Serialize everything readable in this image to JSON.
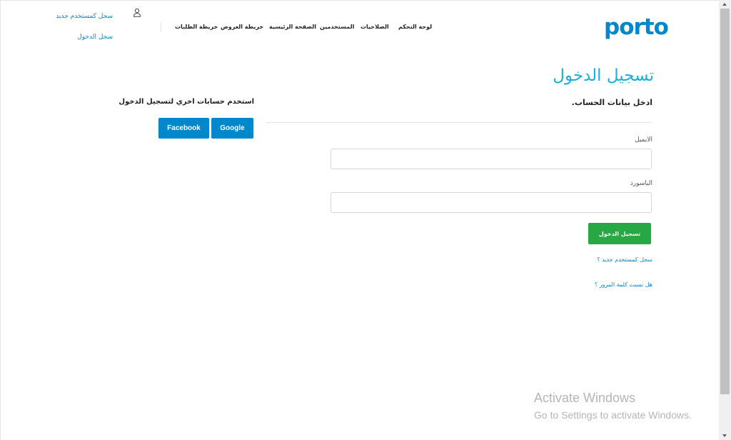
{
  "header": {
    "logo": "porto",
    "nav": [
      {
        "label": "لوحة التحكم"
      },
      {
        "label": "الصلاحيات"
      },
      {
        "label": "المستخدمين"
      },
      {
        "label": "الصفحة الرئيسية"
      },
      {
        "label": "خريطة العروض"
      },
      {
        "label": "خريطة الطلبات"
      }
    ],
    "register_link": "سجل كمستخدم جديد",
    "login_link": "سجل الدخول"
  },
  "main": {
    "page_title": "تسجيل الدخول",
    "form_title": "ادخل بيانات الحساب.",
    "email_label": "الايميل",
    "email_value": "",
    "password_label": "الباسورد",
    "password_value": "",
    "login_button": "تسجيل الدخول",
    "register_link": "سجل كمستخدم جديد ؟",
    "forgot_link": "هل نسيت كلمة المرور ؟"
  },
  "social": {
    "title": "استخدم حسابات اخري لتسجيل الدخول",
    "google": "Google",
    "facebook": "Facebook"
  },
  "watermark": {
    "title": "Activate Windows",
    "subtitle": "Go to Settings to activate Windows."
  },
  "colors": {
    "brand": "#0088cc",
    "title": "#1ab0d6",
    "success": "#28a745"
  }
}
